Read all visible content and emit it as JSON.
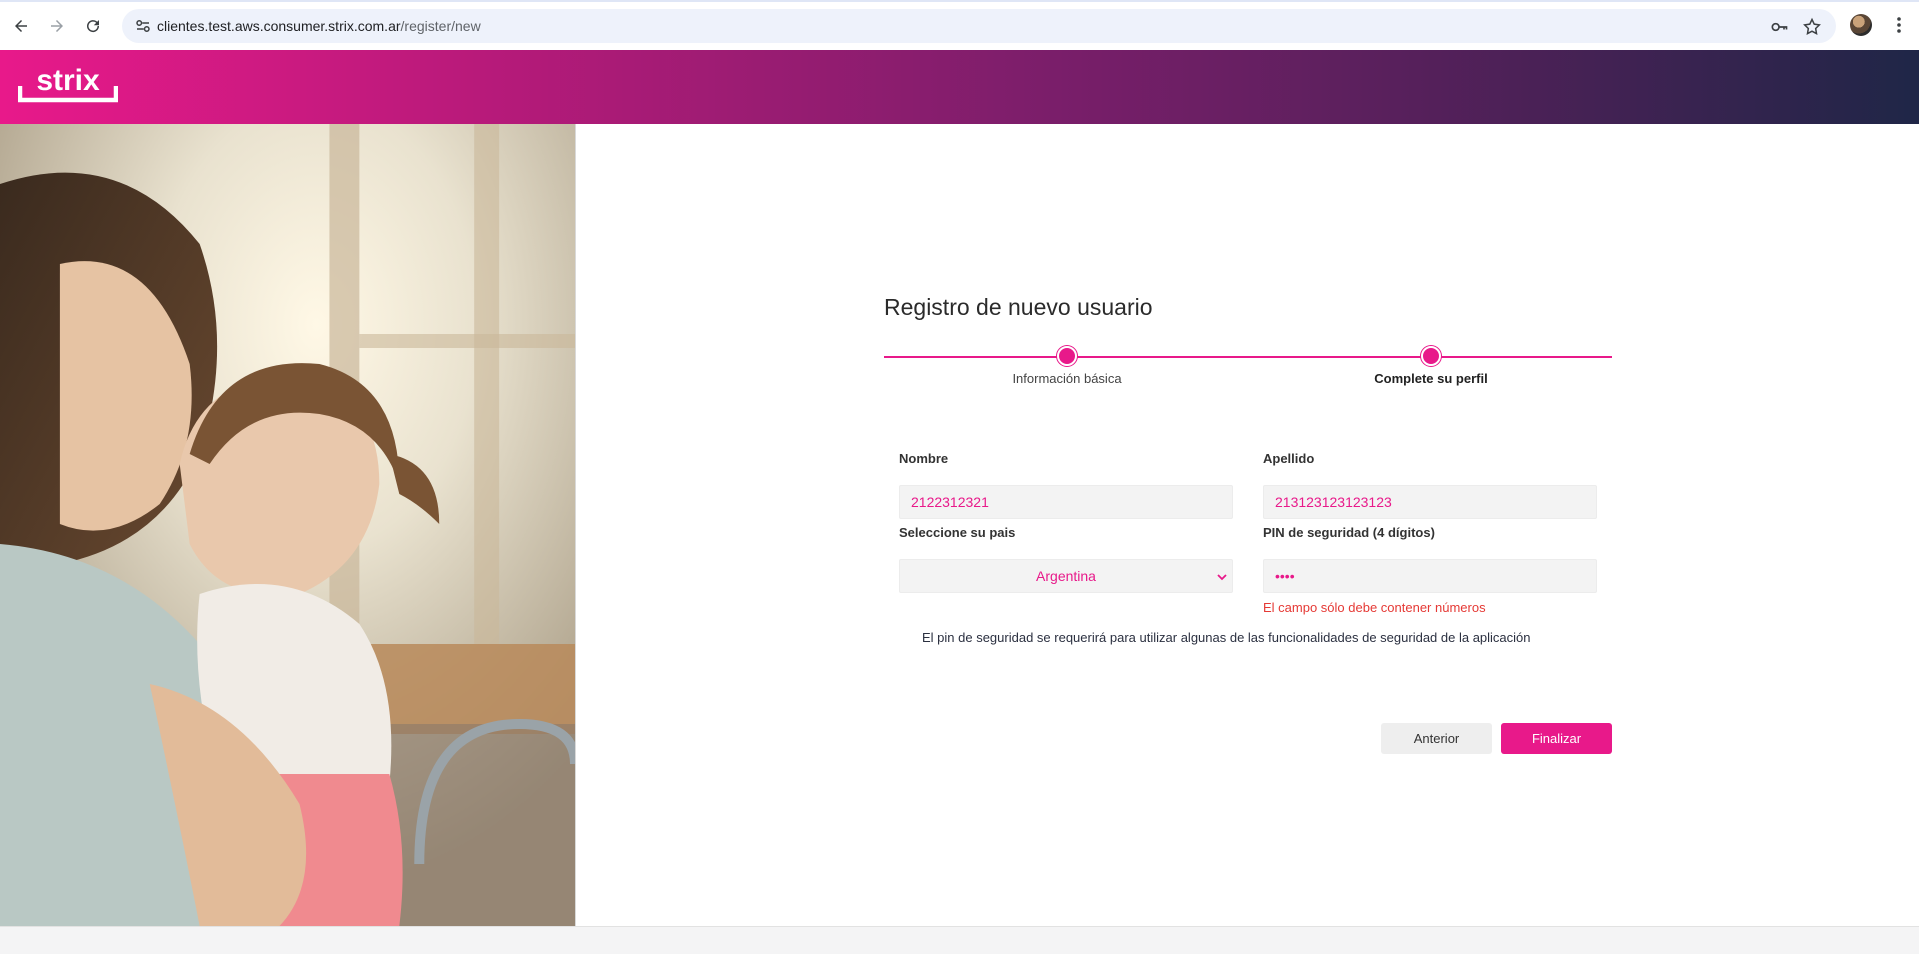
{
  "browser": {
    "url_host": "clientes.test.aws.consumer.strix.com.ar",
    "url_path": "/register/new",
    "icons": [
      "back-icon",
      "forward-icon",
      "reload-icon",
      "site-info-icon",
      "key-icon",
      "star-icon",
      "avatar",
      "menu-icon"
    ]
  },
  "header": {
    "logo_text": "strix",
    "gradient_colors": [
      "#e8198a",
      "#1f2647"
    ]
  },
  "form": {
    "title": "Registro de nuevo usuario",
    "steps": [
      {
        "label": "Información básica"
      },
      {
        "label": "Complete su perfil"
      }
    ],
    "nombre": {
      "label": "Nombre",
      "value": "2122312321"
    },
    "apellido": {
      "label": "Apellido",
      "value": "213123123123123"
    },
    "pais": {
      "label": "Seleccione su pais",
      "selected": "Argentina"
    },
    "pin": {
      "label": "PIN de seguridad (4 dígitos)",
      "value": "••••",
      "error": "El campo sólo debe contener números"
    },
    "info": "El pin de seguridad se requerirá para utilizar algunas de las funcionalidades de seguridad de la aplicación",
    "buttons": {
      "back": "Anterior",
      "submit": "Finalizar"
    }
  },
  "colors": {
    "accent": "#e8198a",
    "error": "#e53935"
  }
}
